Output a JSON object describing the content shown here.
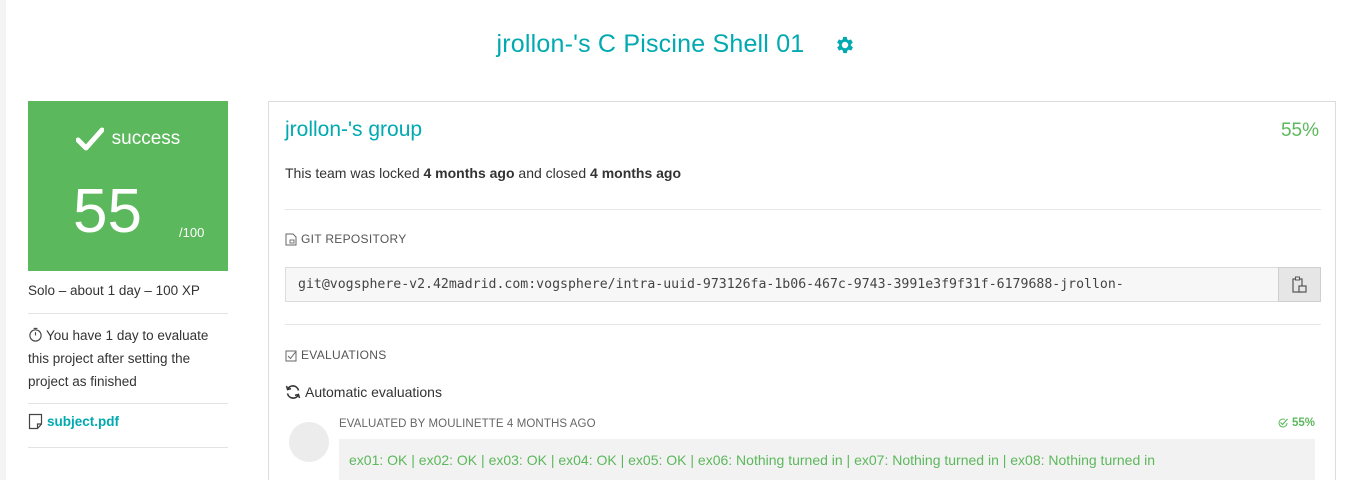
{
  "header": {
    "title": "jrollon-'s C Piscine Shell 01",
    "settings_icon": "gear-icon"
  },
  "status": {
    "label": "success",
    "score": "55",
    "max": "/100",
    "color": "#5cb85c",
    "icon": "check-icon"
  },
  "sidebar": {
    "solo_info": "Solo – about 1 day – 100 XP",
    "deadline_text": "You have 1 day to evaluate this project after setting the project as finished",
    "subject_link": "subject.pdf"
  },
  "team": {
    "name": "jrollon-'s group",
    "percent": "55%",
    "lock_prefix": "This team was locked ",
    "locked_when": "4 months ago",
    "lock_mid": " and closed ",
    "closed_when": "4 months ago"
  },
  "git": {
    "section_label": "GIT REPOSITORY",
    "url": "git@vogsphere-v2.42madrid.com:vogsphere/intra-uuid-973126fa-1b06-467c-9743-3991e3f9f31f-6179688-jrollon-"
  },
  "evaluations": {
    "section_label": "EVALUATIONS",
    "auto_label": "Automatic evaluations",
    "items": [
      {
        "evaluated_by": "EVALUATED BY MOULINETTE 4 MONTHS AGO",
        "percent": "55%",
        "result": "ex01: OK | ex02: OK | ex03: OK | ex04: OK | ex05: OK | ex06: Nothing turned in | ex07: Nothing turned in | ex08: Nothing turned in"
      }
    ]
  },
  "colors": {
    "accent": "#00aab0",
    "success": "#5cb85c"
  }
}
